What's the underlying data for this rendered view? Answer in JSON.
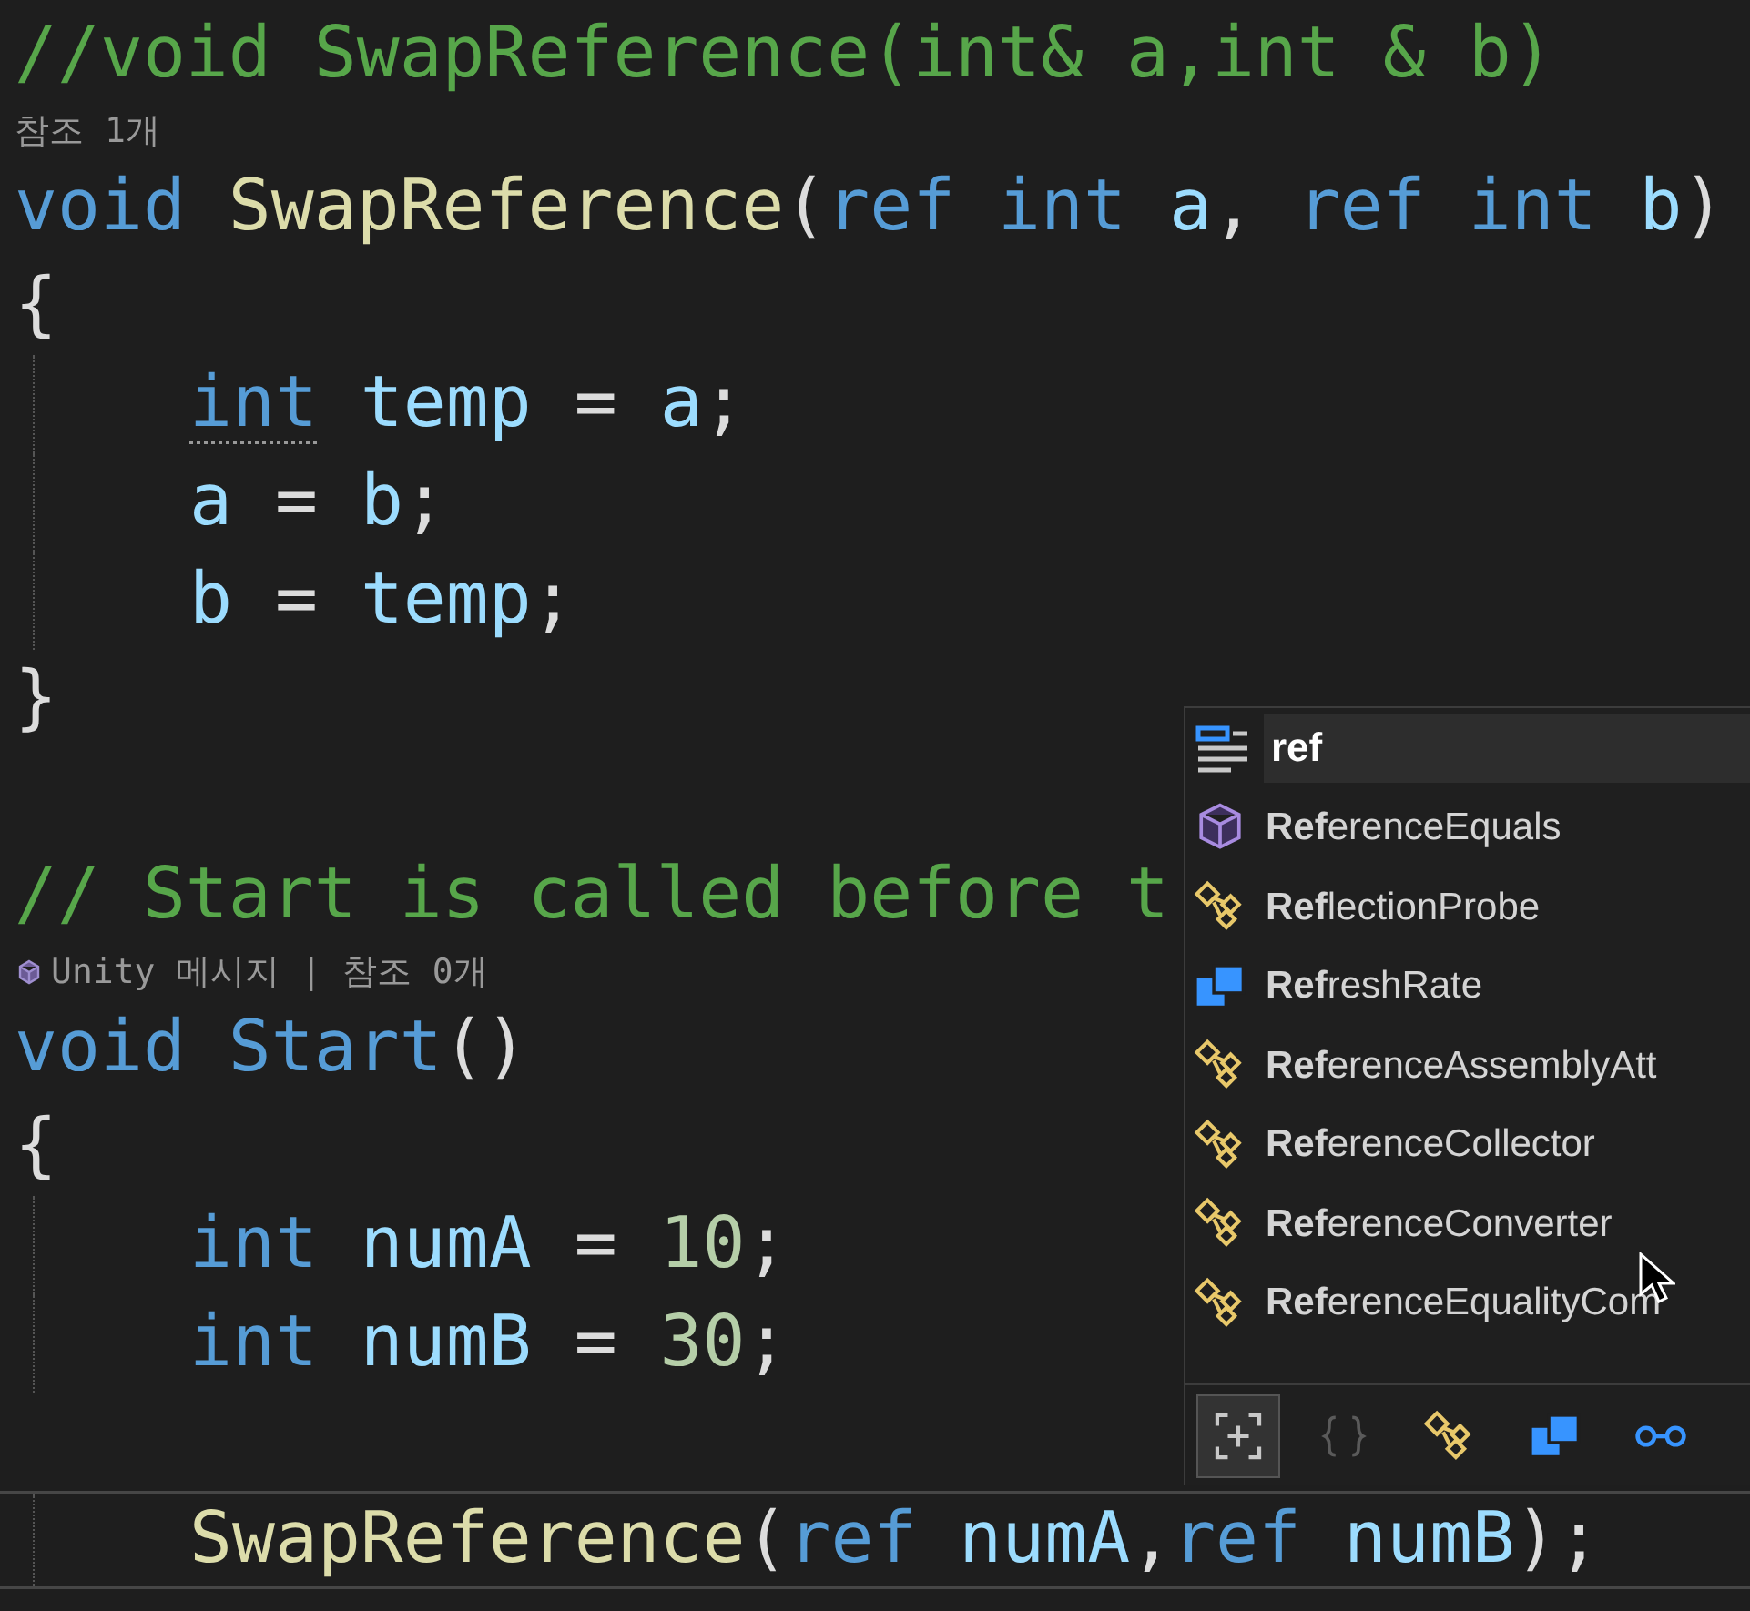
{
  "editor": {
    "lines": [
      {
        "kind": "code",
        "indented": false,
        "current": false,
        "tokens": [
          {
            "kind": "comment",
            "s": "//void SwapReference(int& a,int & b)"
          }
        ]
      },
      {
        "kind": "lens",
        "icon": false,
        "text": "참조 1개"
      },
      {
        "kind": "code",
        "indented": false,
        "current": false,
        "tokens": [
          {
            "kind": "keyword",
            "s": "void "
          },
          {
            "kind": "function",
            "s": "SwapReference"
          },
          {
            "kind": "plain",
            "s": "("
          },
          {
            "kind": "keyword",
            "s": "ref int "
          },
          {
            "kind": "ident",
            "s": "a"
          },
          {
            "kind": "plain",
            "s": ", "
          },
          {
            "kind": "keyword",
            "s": "ref int "
          },
          {
            "kind": "ident",
            "s": "b"
          },
          {
            "kind": "plain",
            "s": ")"
          }
        ]
      },
      {
        "kind": "code",
        "indented": false,
        "current": false,
        "tokens": [
          {
            "kind": "plain",
            "s": "{"
          }
        ]
      },
      {
        "kind": "code",
        "indented": true,
        "current": false,
        "tokens": [
          {
            "kind": "keyword",
            "s": "int",
            "suggestion": true
          },
          {
            "kind": "ident",
            "s": " temp"
          },
          {
            "kind": "plain",
            "s": " = "
          },
          {
            "kind": "ident",
            "s": "a"
          },
          {
            "kind": "plain",
            "s": ";"
          }
        ]
      },
      {
        "kind": "code",
        "indented": true,
        "current": false,
        "tokens": [
          {
            "kind": "ident",
            "s": "a"
          },
          {
            "kind": "plain",
            "s": " = "
          },
          {
            "kind": "ident",
            "s": "b"
          },
          {
            "kind": "plain",
            "s": ";"
          }
        ]
      },
      {
        "kind": "code",
        "indented": true,
        "current": false,
        "tokens": [
          {
            "kind": "ident",
            "s": "b"
          },
          {
            "kind": "plain",
            "s": " = "
          },
          {
            "kind": "ident",
            "s": "temp"
          },
          {
            "kind": "plain",
            "s": ";"
          }
        ]
      },
      {
        "kind": "code",
        "indented": false,
        "current": false,
        "tokens": [
          {
            "kind": "plain",
            "s": "}"
          }
        ]
      },
      {
        "kind": "blank"
      },
      {
        "kind": "code",
        "indented": false,
        "current": false,
        "tokens": [
          {
            "kind": "comment",
            "s": "// Start is called before t"
          }
        ]
      },
      {
        "kind": "lens",
        "icon": true,
        "text": "Unity 메시지 | 참조 0개"
      },
      {
        "kind": "code",
        "indented": false,
        "current": false,
        "tokens": [
          {
            "kind": "keyword",
            "s": "void "
          },
          {
            "kind": "keyword",
            "s": "Start"
          },
          {
            "kind": "plain",
            "s": "()"
          }
        ]
      },
      {
        "kind": "code",
        "indented": false,
        "current": false,
        "tokens": [
          {
            "kind": "plain",
            "s": "{"
          }
        ]
      },
      {
        "kind": "code",
        "indented": true,
        "current": false,
        "tokens": [
          {
            "kind": "keyword",
            "s": "int "
          },
          {
            "kind": "ident",
            "s": "numA"
          },
          {
            "kind": "plain",
            "s": " = "
          },
          {
            "kind": "number",
            "s": "10"
          },
          {
            "kind": "plain",
            "s": ";"
          }
        ]
      },
      {
        "kind": "code",
        "indented": true,
        "current": false,
        "tokens": [
          {
            "kind": "keyword",
            "s": "int "
          },
          {
            "kind": "ident",
            "s": "numB"
          },
          {
            "kind": "plain",
            "s": " = "
          },
          {
            "kind": "number",
            "s": "30"
          },
          {
            "kind": "plain",
            "s": ";"
          }
        ]
      },
      {
        "kind": "blank"
      },
      {
        "kind": "code",
        "indented": true,
        "current": true,
        "tokens": [
          {
            "kind": "function",
            "s": "SwapReference"
          },
          {
            "kind": "plain",
            "s": "("
          },
          {
            "kind": "keyword",
            "s": "ref "
          },
          {
            "kind": "ident",
            "s": "numA"
          },
          {
            "kind": "plain",
            "s": ","
          },
          {
            "kind": "keyword",
            "s": "ref "
          },
          {
            "kind": "ident",
            "s": "numB"
          },
          {
            "kind": "plain",
            "s": ");"
          }
        ]
      }
    ]
  },
  "completion": {
    "typed": "ref",
    "items": [
      {
        "kind": "method",
        "label": "**Ref**erenceEquals"
      },
      {
        "kind": "class",
        "label": "**Ref**lectionProbe"
      },
      {
        "kind": "struct",
        "label": "**Ref**reshRate"
      },
      {
        "kind": "class",
        "label": "**Ref**erenceAssemblyAtt"
      },
      {
        "kind": "class",
        "label": "**Ref**erenceCollector"
      },
      {
        "kind": "class",
        "label": "**Ref**erenceConverter"
      },
      {
        "kind": "class",
        "label": "**Ref**erenceEqualityCom"
      }
    ],
    "filters": [
      {
        "kind": "expand",
        "selected": true
      },
      {
        "kind": "snippet",
        "selected": false
      },
      {
        "kind": "class",
        "selected": false
      },
      {
        "kind": "struct",
        "selected": false
      },
      {
        "kind": "interface",
        "selected": false
      }
    ]
  }
}
